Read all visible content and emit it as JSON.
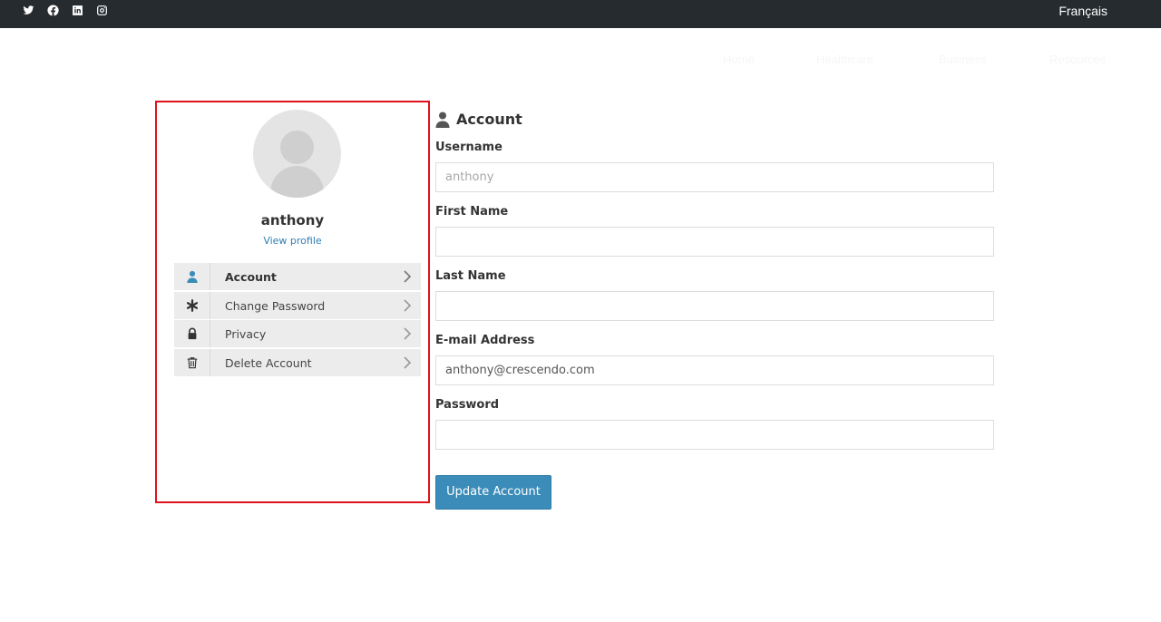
{
  "topbar": {
    "social_icons": [
      "twitter-icon",
      "facebook-icon",
      "linkedin-icon",
      "instagram-icon"
    ],
    "language_link": "Français"
  },
  "nav": {
    "items": [
      "Home",
      "Healthcare",
      "Business",
      "Resources"
    ]
  },
  "profile": {
    "username": "anthony",
    "view_profile_label": "View profile",
    "menu": [
      {
        "label": "Account",
        "icon": "user-icon",
        "active": true
      },
      {
        "label": "Change Password",
        "icon": "asterisk-icon",
        "active": false
      },
      {
        "label": "Privacy",
        "icon": "lock-icon",
        "active": false
      },
      {
        "label": "Delete Account",
        "icon": "trash-icon",
        "active": false
      }
    ]
  },
  "form": {
    "title": "Account",
    "fields": [
      {
        "label": "Username",
        "value": "",
        "placeholder": "anthony"
      },
      {
        "label": "First Name",
        "value": "",
        "placeholder": ""
      },
      {
        "label": "Last Name",
        "value": "",
        "placeholder": ""
      },
      {
        "label": "E-mail Address",
        "value": "anthony@crescendo.com",
        "placeholder": ""
      },
      {
        "label": "Password",
        "value": "",
        "placeholder": ""
      }
    ],
    "submit_label": "Update Account"
  },
  "colors": {
    "topbar": "#262b2f",
    "accent": "#3b8cb9",
    "highlight_border": "#e0121c",
    "menu_bg": "#ececec"
  }
}
